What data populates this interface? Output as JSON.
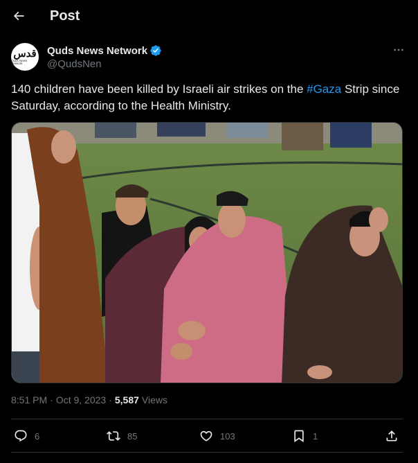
{
  "header": {
    "title": "Post"
  },
  "author": {
    "name": "Quds News Network",
    "handle": "@QudsNen",
    "avatar_text_ar": "قدس",
    "avatar_text_en": "Quds News Network"
  },
  "tweet": {
    "text_before": "140 children have been killed by Israeli air strikes on the ",
    "hashtag": "#Gaza",
    "text_after": " Strip since Saturday, according to the Health Ministry."
  },
  "meta": {
    "time": "8:51 PM",
    "dot1": "·",
    "date": "Oct 9, 2023",
    "dot2": "·",
    "views_count": "5,587",
    "views_label": "Views"
  },
  "actions": {
    "replies": "6",
    "reposts": "85",
    "likes": "103",
    "bookmarks": "1"
  },
  "colors": {
    "background": "#000000",
    "text": "#e7e9ea",
    "muted": "#71767b",
    "accent": "#1d9bf0",
    "divider": "#2f3336"
  }
}
